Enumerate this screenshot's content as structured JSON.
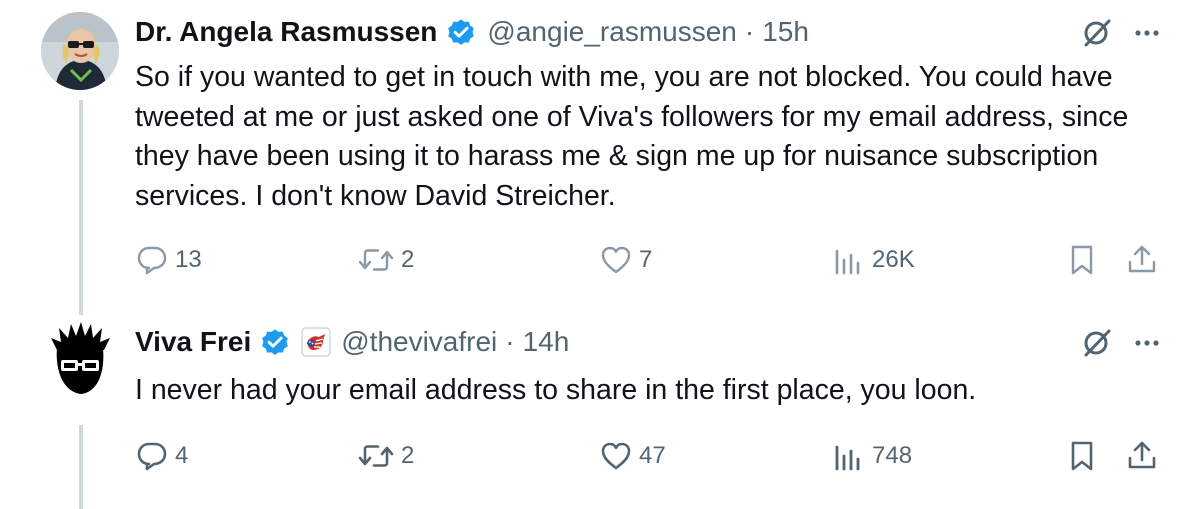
{
  "tweets": [
    {
      "author": {
        "name": "Dr. Angela Rasmussen",
        "handle": "@angie_rasmussen",
        "verified": true
      },
      "separator": "·",
      "time": "15h",
      "text": "So if you wanted to get in touch with me, you are not blocked. You could have tweeted at me or just asked one of Viva's followers for my email address, since they have been using it to harass me & sign me up for nuisance subscription services. I don't know David Streicher.",
      "stats": {
        "replies": "13",
        "reposts": "2",
        "likes": "7",
        "views": "26K"
      },
      "style": "faded"
    },
    {
      "author": {
        "name": "Viva Frei",
        "handle": "@thevivafrei",
        "verified": true,
        "affiliate_badge": "flag-badge-icon"
      },
      "separator": "·",
      "time": "14h",
      "text": "I never had your email address to share in the first place, you loon.",
      "stats": {
        "replies": "4",
        "reposts": "2",
        "likes": "47",
        "views": "748"
      },
      "style": "normal"
    }
  ],
  "icons": {
    "reply": "reply-icon",
    "repost": "repost-icon",
    "like": "heart-icon",
    "views": "views-chart-icon",
    "bookmark": "bookmark-icon",
    "share": "share-icon",
    "grok": "grok-icon",
    "more": "more-options-icon",
    "verified": "verified-badge-icon"
  },
  "colors": {
    "text": "#0f1419",
    "secondary": "#536471",
    "faded_icon": "#8b98a5",
    "verified": "#1d9bf0",
    "thread_line": "#cfd9de"
  }
}
